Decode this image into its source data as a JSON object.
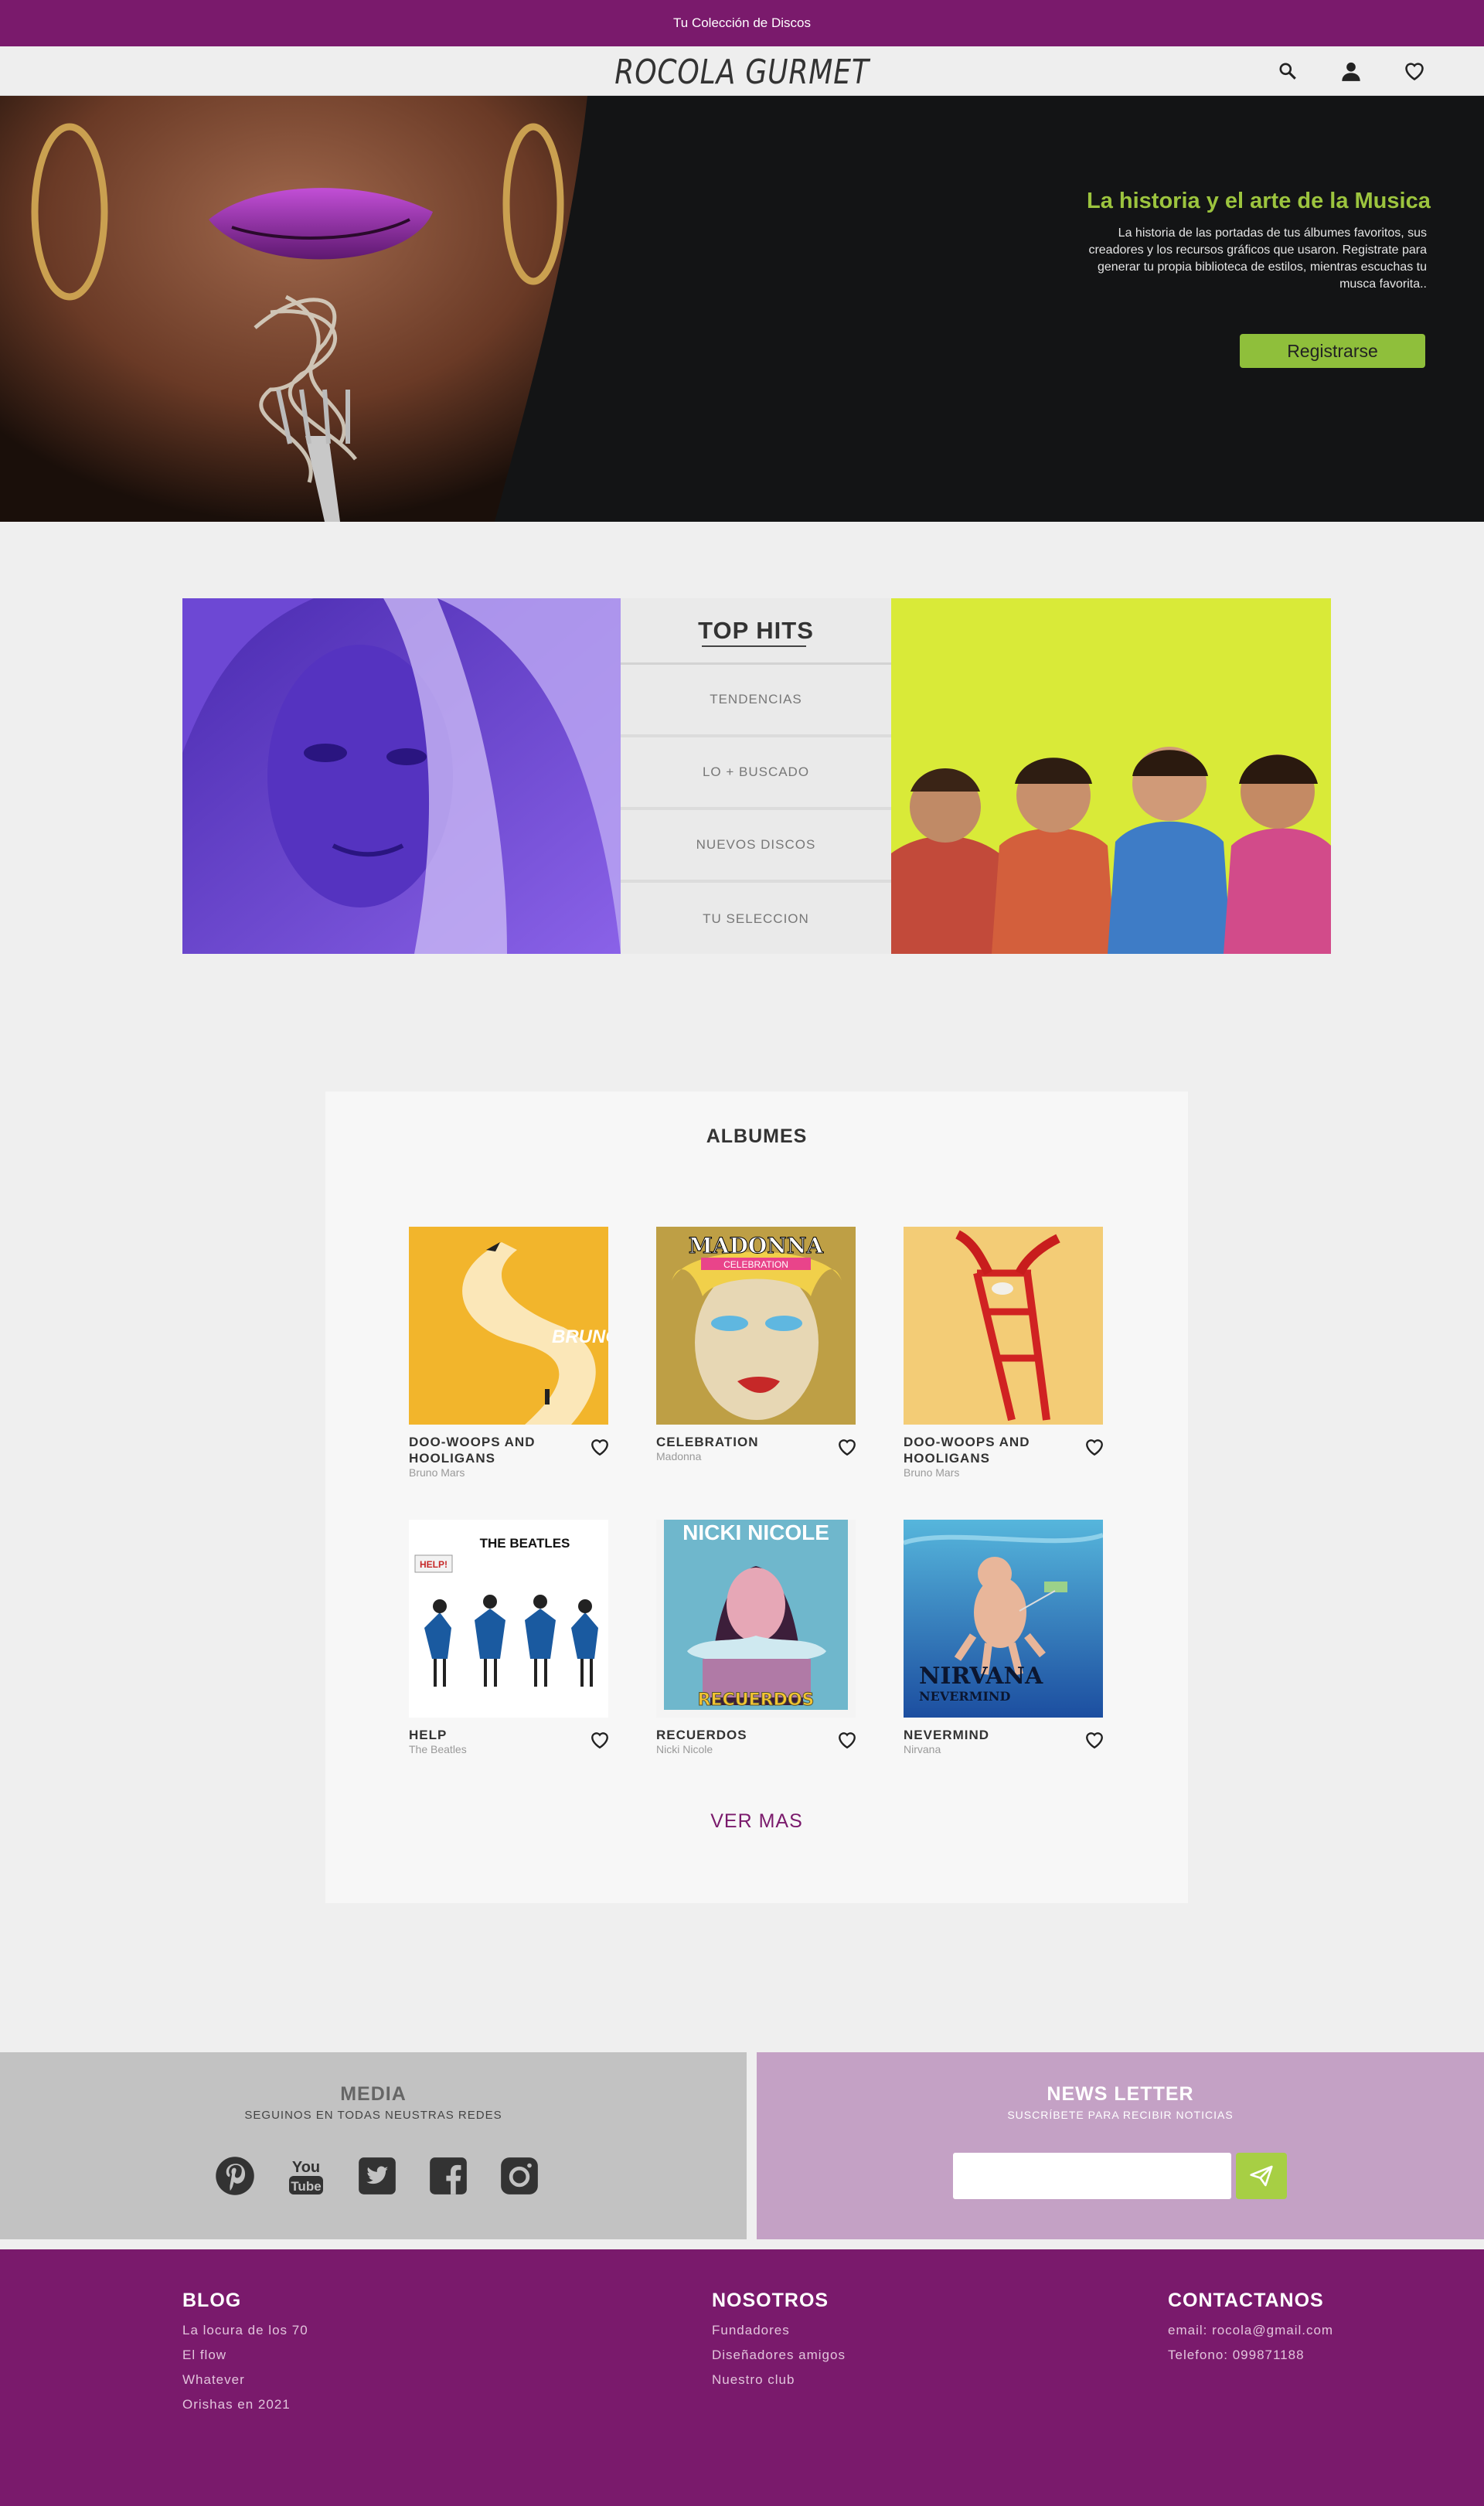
{
  "topbar": {
    "text": "Tu Colección de Discos"
  },
  "header": {
    "logo": "ROCOLA GURMET",
    "icons": [
      "search-icon",
      "user-icon",
      "heart-icon"
    ]
  },
  "hero": {
    "title": "La historia y el arte de la Musica",
    "text": "La historia de las portadas de tus álbumes favoritos, sus creadores y los recursos gráficos que usaron. Registrate para generar tu propia biblioteca de estilos, mientras escuchas tu musca favorita..",
    "cta": "Registrarse"
  },
  "hits": {
    "title": "TOP HITS",
    "items": [
      "TENDENCIAS",
      "LO + BUSCADO",
      "NUEVOS DISCOS",
      "TU SELECCION"
    ]
  },
  "albums": {
    "title": "ALBUMES",
    "items": [
      {
        "name": "DOO-WOOPS AND HOOLIGANS",
        "artist": "Bruno Mars",
        "cover_text": "BRUNO MARS"
      },
      {
        "name": "CELEBRATION",
        "artist": "Madonna",
        "cover_text": "MADONNA",
        "cover_sub": "CELEBRATION"
      },
      {
        "name": "DOO-WOOPS AND HOOLIGANS",
        "artist": "Bruno Mars"
      },
      {
        "name": "HELP",
        "artist": "The Beatles",
        "cover_text": "THE BEATLES",
        "cover_sub": "HELP!"
      },
      {
        "name": "RECUERDOS",
        "artist": "Nicki Nicole",
        "cover_text": "NICKI NICOLE",
        "cover_sub": "RECUERDOS"
      },
      {
        "name": "NEVERMIND",
        "artist": "Nirvana",
        "cover_text": "NIRVANA",
        "cover_sub": "NEVERMIND"
      }
    ],
    "more": "VER MAS"
  },
  "media": {
    "title": "MEDIA",
    "subtitle": "SEGUINOS EN TODAS NEUSTRAS REDES",
    "icons": [
      "pinterest-icon",
      "youtube-icon",
      "twitter-icon",
      "facebook-icon",
      "instagram-icon"
    ],
    "youtube_top": "You",
    "youtube_bottom": "Tube"
  },
  "newsletter": {
    "title": "NEWS LETTER",
    "subtitle": "SUSCRÍBETE PARA RECIBIR NOTICIAS",
    "placeholder": ""
  },
  "footer": {
    "blog": {
      "title": "BLOG",
      "links": [
        "La locura de los 70",
        "El flow",
        "Whatever",
        "Orishas en 2021"
      ]
    },
    "nosotros": {
      "title": "NOSOTROS",
      "links": [
        "Fundadores",
        "Diseñadores amigos",
        "Nuestro club"
      ]
    },
    "contact": {
      "title": "CONTACTANOS",
      "links": [
        "email: rocola@gmail.com",
        "Telefono: 099871188"
      ]
    }
  },
  "colors": {
    "brand": "#7a1a6c",
    "accent": "#9cc43e",
    "newsletter": "#c4a1c5",
    "media": "#c2c2c2"
  }
}
